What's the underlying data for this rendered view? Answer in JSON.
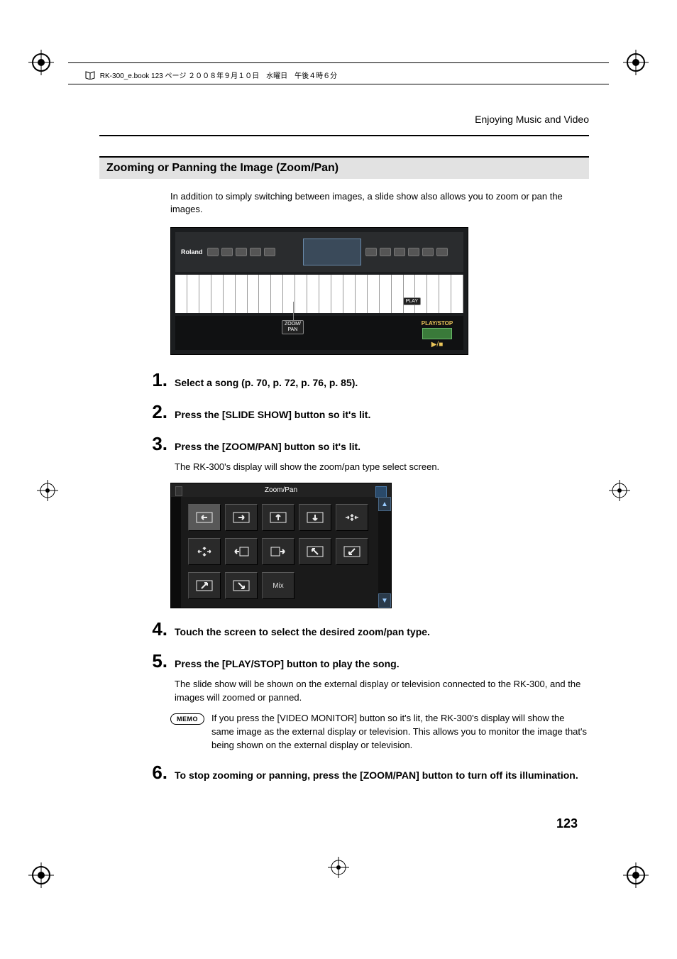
{
  "meta": {
    "book_line": "RK-300_e.book  123 ページ  ２００８年９月１０日　水曜日　午後４時６分"
  },
  "header": {
    "running_head": "Enjoying Music and Video"
  },
  "section": {
    "title": "Zooming or Panning the Image (Zoom/Pan)",
    "intro": "In addition to simply switching between images, a slide show also allows you to zoom or pan the images."
  },
  "keyboard_figure": {
    "brand": "Roland",
    "callout_zoom_pan": "ZOOM/\nPAN",
    "callout_play": "PLAY",
    "play_stop_label": "PLAY/STOP",
    "play_stop_icon": "▶/■"
  },
  "steps": {
    "s1": {
      "num": "1.",
      "head": "Select a song (p. 70, p. 72, p. 76, p. 85)."
    },
    "s2": {
      "num": "2.",
      "head": "Press the [SLIDE SHOW] button so it's lit."
    },
    "s3": {
      "num": "3.",
      "head": "Press the [ZOOM/PAN] button so it's lit.",
      "para": "The RK-300's display will show the zoom/pan type select screen."
    },
    "s4": {
      "num": "4.",
      "head": "Touch the screen to select the desired zoom/pan type."
    },
    "s5": {
      "num": "5.",
      "head": "Press the [PLAY/STOP] button to play the song.",
      "para": "The slide show will be shown on the external display or television connected to the RK-300, and the images will zoomed or panned."
    },
    "s6": {
      "num": "6.",
      "head": "To stop zooming or panning, press the [ZOOM/PAN] button to turn off its illumination."
    }
  },
  "zoom_pan_screen": {
    "title": "Zoom/Pan",
    "mix_label": "Mix"
  },
  "memo": {
    "badge": "MEMO",
    "text": "If you press the [VIDEO MONITOR] button so it's lit, the RK-300's display will show the same image as the external display or television. This allows you to monitor the image that's being shown on the external display or television."
  },
  "page_number": "123"
}
